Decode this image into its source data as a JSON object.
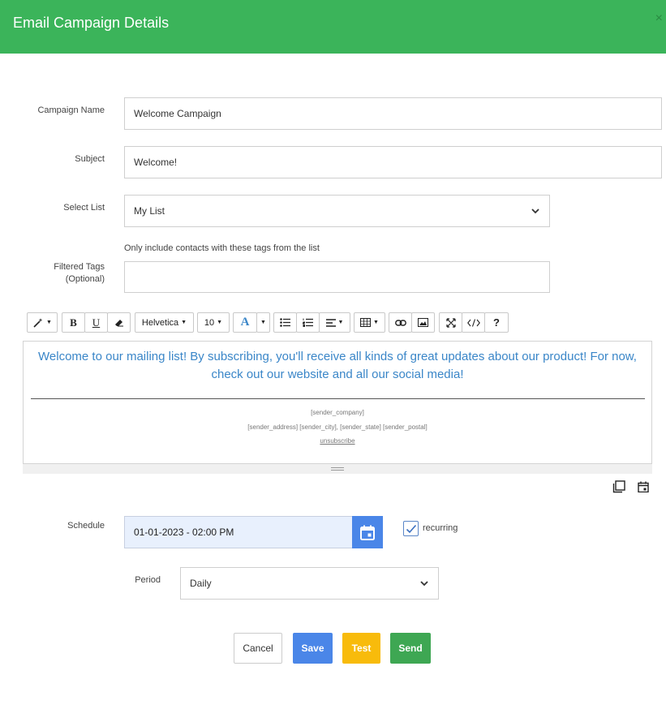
{
  "dialog": {
    "title": "Email Campaign Details",
    "close_glyph": "×"
  },
  "form": {
    "campaign_name_label": "Campaign Name",
    "campaign_name_value": "Welcome Campaign",
    "subject_label": "Subject",
    "subject_value": "Welcome!",
    "select_list_label": "Select List",
    "select_list_value": "My List",
    "filtered_tags_hint": "Only include contacts with these tags from the list",
    "filtered_tags_label_line1": "Filtered Tags",
    "filtered_tags_label_line2": "(Optional)",
    "filtered_tags_value": ""
  },
  "toolbar": {
    "font_family": "Helvetica",
    "font_size": "10",
    "bold": "B",
    "underline": "U",
    "color_letter": "A",
    "help": "?"
  },
  "editor": {
    "body_text": "Welcome to our mailing list! By subscribing, you'll receive all kinds of great updates about our product! For now, check out our website and all our social media!",
    "footer_company": "[sender_company]",
    "footer_address": "[sender_address] [sender_city], [sender_state] [sender_postal]",
    "footer_unsubscribe": "unsubscribe"
  },
  "schedule": {
    "label": "Schedule",
    "datetime_value": "01-01-2023 - 02:00 PM",
    "recurring_label": "recurring",
    "recurring_checked": true,
    "period_label": "Period",
    "period_value": "Daily"
  },
  "actions": {
    "cancel": "Cancel",
    "save": "Save",
    "test": "Test",
    "send": "Send"
  },
  "colors": {
    "header": "#3bb45a",
    "save": "#4a86e8",
    "test": "#f8bb0b",
    "send": "#3ea753",
    "editor_text": "#3a86c8"
  }
}
